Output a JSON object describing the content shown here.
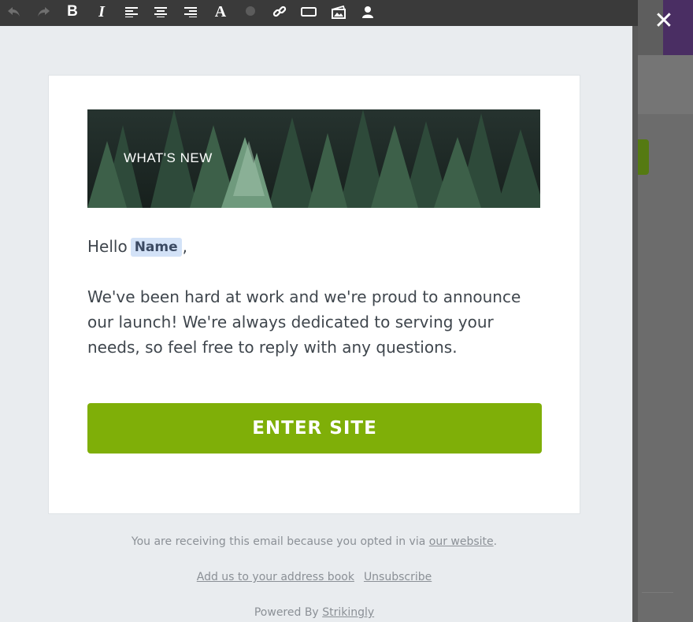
{
  "toolbar": {
    "buttons": [
      {
        "icon": "undo-icon"
      },
      {
        "icon": "redo-icon"
      },
      {
        "icon": "bold-icon",
        "glyph": "B"
      },
      {
        "icon": "italic-icon",
        "glyph": "I"
      },
      {
        "icon": "align-left-icon"
      },
      {
        "icon": "align-center-icon"
      },
      {
        "icon": "align-right-icon"
      },
      {
        "icon": "font-icon",
        "glyph": "A"
      },
      {
        "icon": "color-dot-icon"
      },
      {
        "icon": "link-icon"
      },
      {
        "icon": "button-icon"
      },
      {
        "icon": "image-icon"
      },
      {
        "icon": "user-icon"
      }
    ]
  },
  "overlay": {
    "close_glyph": "✕"
  },
  "banner": {
    "title": "WHAT'S NEW"
  },
  "email": {
    "greeting": "Hello",
    "merge_tag": "Name",
    "comma": ",",
    "body_lines": [
      "We've been hard at work and we're proud to announce",
      "our launch! We're always dedicated to serving your",
      "needs, so feel free to reply with any questions."
    ],
    "cta_label": "ENTER SITE"
  },
  "footer": {
    "opt_in_text": "You are receiving this email because you opted in via",
    "opt_in_link": "our website",
    "opt_in_period": ".",
    "address_book_link": "Add us to your address book",
    "unsubscribe_link": "Unsubscribe",
    "powered_by": "Powered By",
    "powered_by_link": "Strikingly"
  },
  "colors": {
    "toolbar_bg": "#3a3a3a",
    "panel_bg": "#e9ecef",
    "cta_green": "#7faf08",
    "merge_tag_bg": "#d3e2f7"
  }
}
